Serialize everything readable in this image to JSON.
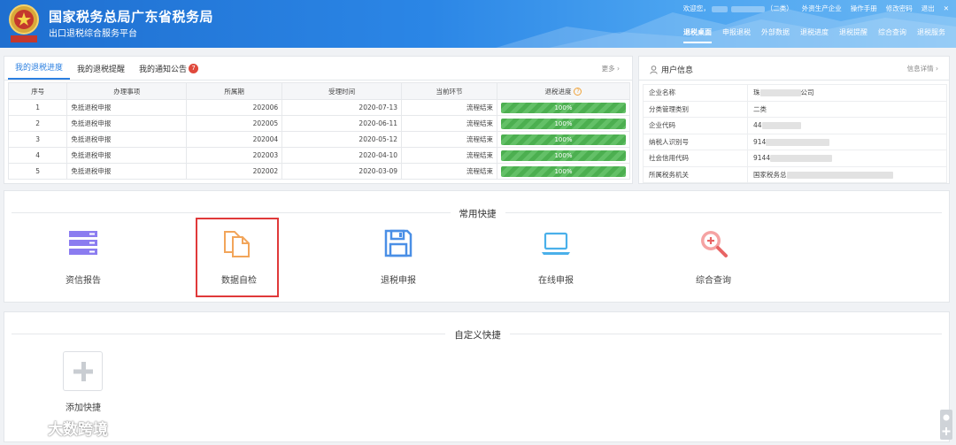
{
  "header": {
    "title": "国家税务总局广东省税务局",
    "subtitle": "出口退税综合服务平台",
    "topbar": {
      "welcome": "欢迎您，",
      "user_tag": "（二类）",
      "links": [
        "外资生产企业",
        "操作手册",
        "修改密码",
        "退出"
      ]
    },
    "nav": [
      "退税桌面",
      "申报退税",
      "外部数据",
      "退税进度",
      "退税提醒",
      "综合查询",
      "退税服务"
    ],
    "active_nav": "退税桌面"
  },
  "progress_panel": {
    "tabs": [
      {
        "label": "我的退税进度"
      },
      {
        "label": "我的退税提醒"
      },
      {
        "label": "我的通知公告",
        "badge": "7"
      }
    ],
    "more": "更多",
    "columns": [
      "序号",
      "办理事项",
      "所属期",
      "受理时间",
      "当前环节",
      "退税进度"
    ],
    "rows": [
      {
        "no": "1",
        "item": "免抵退税申报",
        "period": "202006",
        "time": "2020-07-13",
        "stage": "流程结束",
        "progress": "100%"
      },
      {
        "no": "2",
        "item": "免抵退税申报",
        "period": "202005",
        "time": "2020-06-11",
        "stage": "流程结束",
        "progress": "100%"
      },
      {
        "no": "3",
        "item": "免抵退税申报",
        "period": "202004",
        "time": "2020-05-12",
        "stage": "流程结束",
        "progress": "100%"
      },
      {
        "no": "4",
        "item": "免抵退税申报",
        "period": "202003",
        "time": "2020-04-10",
        "stage": "流程结束",
        "progress": "100%"
      },
      {
        "no": "5",
        "item": "免抵退税申报",
        "period": "202002",
        "time": "2020-03-09",
        "stage": "流程结束",
        "progress": "100%"
      }
    ]
  },
  "user_panel": {
    "title": "用户信息",
    "more": "信息详情",
    "rows": [
      {
        "label": "企业名称",
        "value_prefix": "珠",
        "value_suffix": "公司"
      },
      {
        "label": "分类管理类别",
        "value_prefix": "二类",
        "value_suffix": ""
      },
      {
        "label": "企业代码",
        "value_prefix": "44",
        "value_suffix": ""
      },
      {
        "label": "纳税人识别号",
        "value_prefix": "914",
        "value_suffix": ""
      },
      {
        "label": "社会信用代码",
        "value_prefix": "9144",
        "value_suffix": ""
      },
      {
        "label": "所属税务机关",
        "value_prefix": "国家税务总",
        "value_suffix": ""
      }
    ]
  },
  "common": {
    "title": "常用快捷",
    "items": [
      {
        "label": "资信报告",
        "icon": "server-stack-icon"
      },
      {
        "label": "数据自检",
        "icon": "document-copy-icon"
      },
      {
        "label": "退税申报",
        "icon": "save-disk-icon"
      },
      {
        "label": "在线申报",
        "icon": "laptop-icon"
      },
      {
        "label": "综合查询",
        "icon": "zoom-in-icon"
      }
    ]
  },
  "custom": {
    "title": "自定义快捷",
    "add_label": "添加快捷"
  },
  "watermark": {
    "text": "大数跨境"
  },
  "colors": {
    "primary": "#2b7fe0",
    "progress_green": "#4caf50",
    "highlight_red": "#e0393a",
    "badge_red": "#e0493c"
  }
}
